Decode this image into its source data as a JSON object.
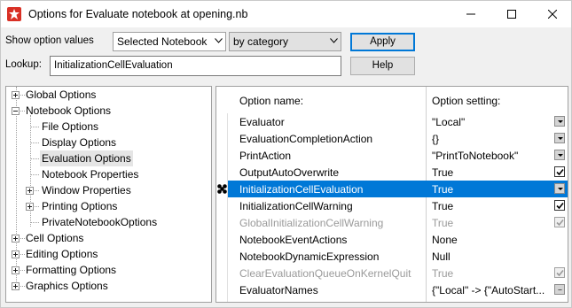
{
  "window": {
    "title": "Options for Evaluate notebook at opening.nb"
  },
  "controls": {
    "show_label": "Show option values",
    "scope_value": "Selected Notebook",
    "grouping_value": "by category",
    "apply_label": "Apply",
    "lookup_label": "Lookup:",
    "lookup_value": "InitializationCellEvaluation",
    "help_label": "Help"
  },
  "tree": {
    "items": [
      {
        "label": "Global Options",
        "expander": "plus"
      },
      {
        "label": "Notebook Options",
        "expander": "minus"
      },
      {
        "label": "File Options",
        "expander": "none"
      },
      {
        "label": "Display Options",
        "expander": "none"
      },
      {
        "label": "Evaluation Options",
        "expander": "none",
        "selected": true
      },
      {
        "label": "Notebook Properties",
        "expander": "none"
      },
      {
        "label": "Window Properties",
        "expander": "plus"
      },
      {
        "label": "Printing Options",
        "expander": "plus"
      },
      {
        "label": "PrivateNotebookOptions",
        "expander": "none"
      },
      {
        "label": "Cell Options",
        "expander": "plus"
      },
      {
        "label": "Editing Options",
        "expander": "plus"
      },
      {
        "label": "Formatting Options",
        "expander": "plus"
      },
      {
        "label": "Graphics Options",
        "expander": "plus"
      }
    ]
  },
  "grid": {
    "col_name": "Option name:",
    "col_setting": "Option setting:",
    "rows": [
      {
        "name": "Evaluator",
        "value": "\"Local\"",
        "control": "dropdown"
      },
      {
        "name": "EvaluationCompletionAction",
        "value": "{}",
        "control": "dropdown"
      },
      {
        "name": "PrintAction",
        "value": "\"PrintToNotebook\"",
        "control": "dropdown"
      },
      {
        "name": "OutputAutoOverwrite",
        "value": "True",
        "control": "checkbox"
      },
      {
        "name": "InitializationCellEvaluation",
        "value": "True",
        "control": "dropdown",
        "selected": true
      },
      {
        "name": "InitializationCellWarning",
        "value": "True",
        "control": "checkbox"
      },
      {
        "name": "GlobalInitializationCellWarning",
        "value": "True",
        "control": "checkbox",
        "dim": true
      },
      {
        "name": "NotebookEventActions",
        "value": "None",
        "control": "none"
      },
      {
        "name": "NotebookDynamicExpression",
        "value": "Null",
        "control": "none"
      },
      {
        "name": "ClearEvaluationQueueOnKernelQuit",
        "value": "True",
        "control": "checkbox",
        "dim": true
      },
      {
        "name": "EvaluatorNames",
        "value": "{\"Local\" -> {\"AutoStart...",
        "control": "ellipsis"
      }
    ]
  },
  "colors": {
    "selection": "#0078d7",
    "app_icon": "#d93025"
  }
}
